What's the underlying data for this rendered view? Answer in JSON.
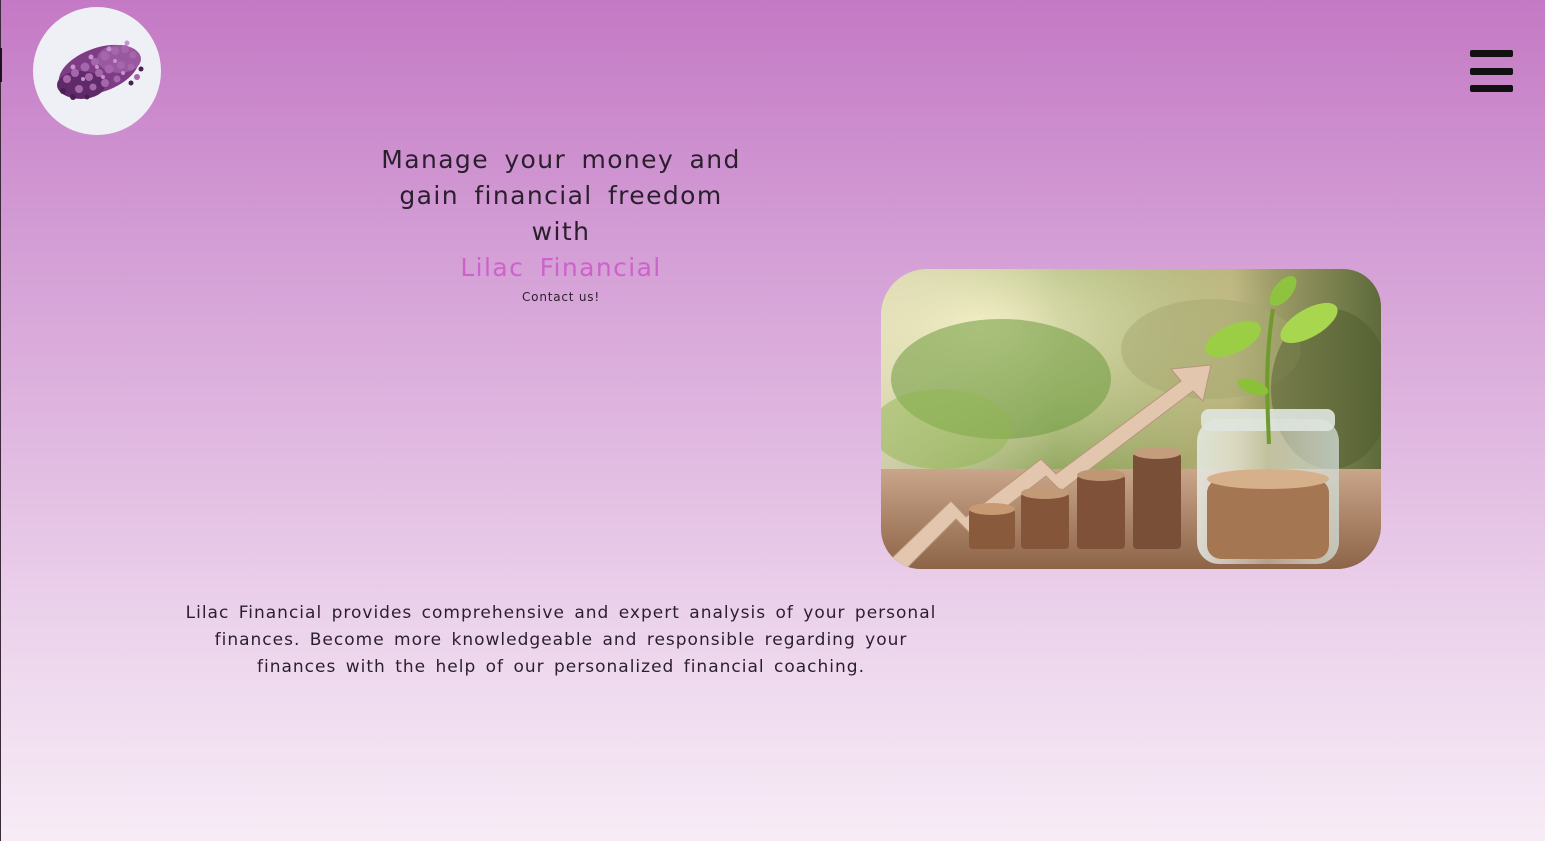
{
  "site": {
    "logo_icon": "lilac-flower-icon",
    "menu_icon": "hamburger-menu-icon"
  },
  "hero": {
    "headline_line1": "Manage your money and",
    "headline_line2": "gain financial freedom with",
    "brand_name": "Lilac Financial",
    "contact_link": "Contact us!",
    "image_icon": "growth-chart-coins-plant-image"
  },
  "about": {
    "description": "Lilac Financial provides comprehensive and expert analysis of your personal finances. Become more knowledgeable and responsible regarding your finances with the help of our personalized financial coaching."
  },
  "colors": {
    "background_top": "#c479c4",
    "background_bottom": "#f7ecf6",
    "brand_accent": "#cd62cb",
    "text": "#2b1f2e"
  }
}
